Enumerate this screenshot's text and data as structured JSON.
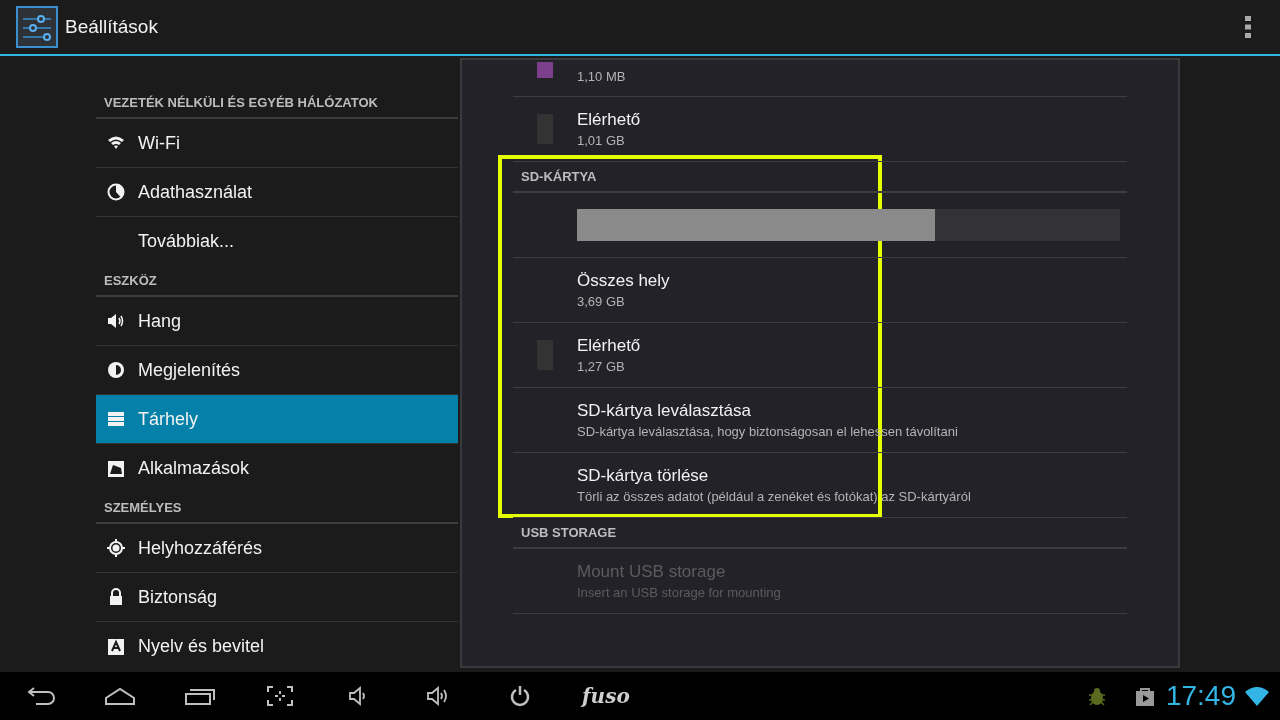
{
  "app_bar": {
    "title": "Beállítások"
  },
  "sidebar": {
    "sections": [
      {
        "heading": "VEZETÉK NÉLKÜLI ÉS EGYÉB HÁLÓZATOK",
        "items": [
          {
            "label": "Wi-Fi",
            "selected": false
          },
          {
            "label": "Adathasználat",
            "selected": false
          },
          {
            "label": "Továbbiak...",
            "selected": false
          }
        ]
      },
      {
        "heading": "ESZKÖZ",
        "items": [
          {
            "label": "Hang",
            "selected": false
          },
          {
            "label": "Megjelenítés",
            "selected": false
          },
          {
            "label": "Tárhely",
            "selected": true
          },
          {
            "label": "Alkalmazások",
            "selected": false
          }
        ]
      },
      {
        "heading": "SZEMÉLYES",
        "items": [
          {
            "label": "Helyhozzáférés",
            "selected": false
          },
          {
            "label": "Biztonság",
            "selected": false
          },
          {
            "label": "Nyelv és bevitel",
            "selected": false
          }
        ]
      }
    ]
  },
  "storage": {
    "items": [
      {
        "kind": "entry",
        "value": "1,10 MB",
        "color": "#7b3f8c"
      },
      {
        "kind": "entry",
        "title": "Elérhető",
        "value": "1,01 GB",
        "color": "#333333"
      },
      {
        "kind": "heading",
        "title": "SD-KÁRTYA"
      },
      {
        "kind": "bar",
        "level": 0.66
      },
      {
        "kind": "entry",
        "title": "Összes hely",
        "value": "3,69 GB"
      },
      {
        "kind": "entry",
        "title": "Elérhető",
        "value": "1,27 GB",
        "color": "#333333"
      },
      {
        "kind": "action",
        "title": "SD-kártya leválasztása",
        "summary": "SD-kártya leválasztása, hogy biztonságosan el lehessen távolítani",
        "disabled": false
      },
      {
        "kind": "action",
        "title": "SD-kártya törlése",
        "summary": "Törli az összes adatot (például a zenéket és fotókat) az SD-kártyáról",
        "disabled": false
      },
      {
        "kind": "heading",
        "title": "USB STORAGE"
      },
      {
        "kind": "action",
        "title": "Mount USB storage",
        "summary": "Insert an USB storage for mounting",
        "disabled": true
      }
    ]
  },
  "nav_bar": {
    "brand": "fuso",
    "clock": "17:49"
  }
}
